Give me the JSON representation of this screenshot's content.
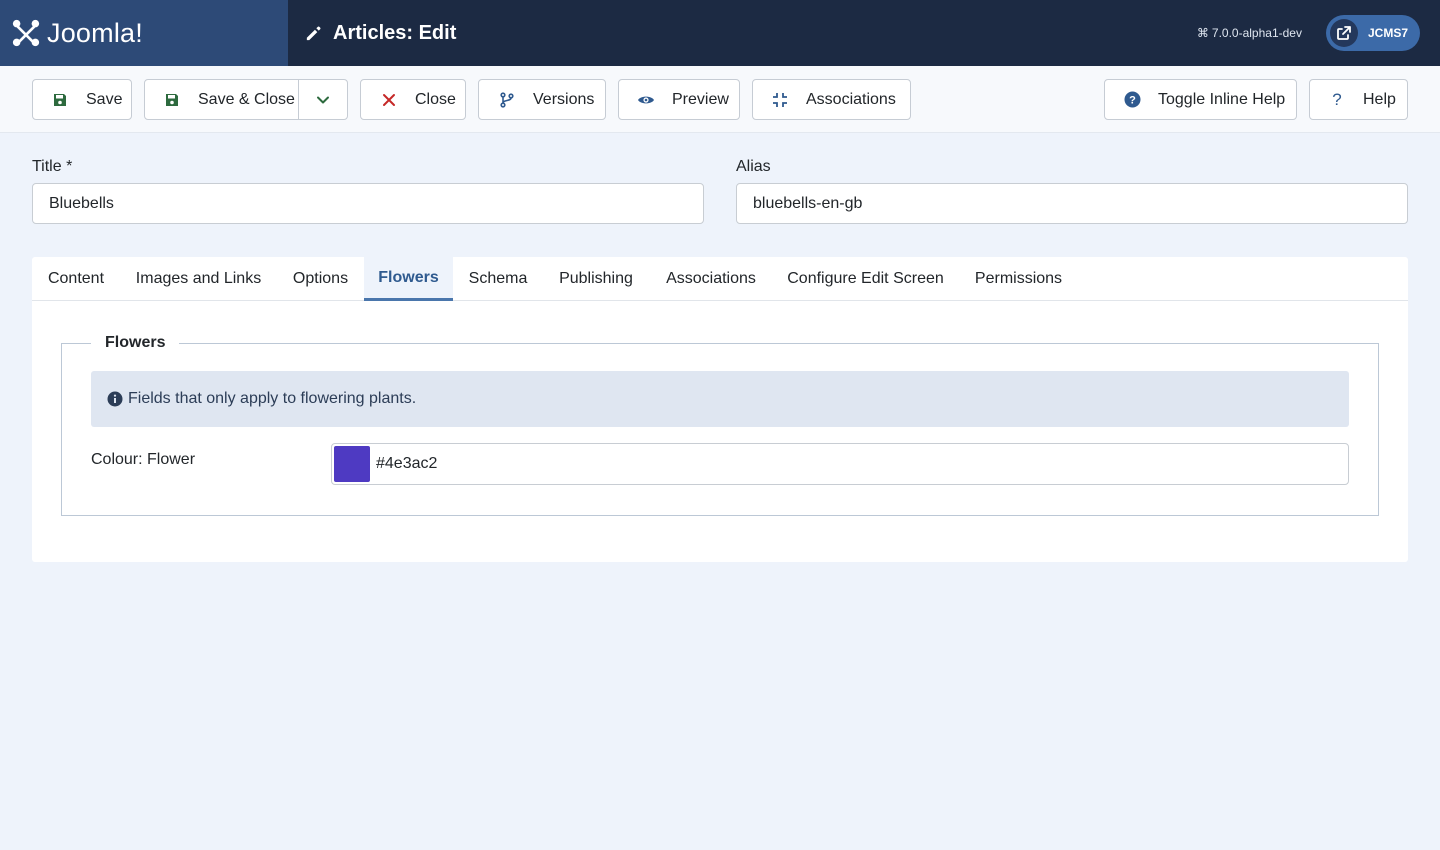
{
  "header": {
    "brand": "Joomla!",
    "page_title": "Articles: Edit",
    "version": "7.0.0-alpha1-dev",
    "user_label": "JCMS7"
  },
  "toolbar": {
    "save": "Save",
    "save_close": "Save & Close",
    "close": "Close",
    "versions": "Versions",
    "preview": "Preview",
    "associations": "Associations",
    "toggle_help": "Toggle Inline Help",
    "help": "Help"
  },
  "form": {
    "title_label": "Title *",
    "title_value": "Bluebells",
    "alias_label": "Alias",
    "alias_value": "bluebells-en-gb"
  },
  "tabs": [
    {
      "label": "Content",
      "active": false
    },
    {
      "label": "Images and Links",
      "active": false
    },
    {
      "label": "Options",
      "active": false
    },
    {
      "label": "Flowers",
      "active": true
    },
    {
      "label": "Schema",
      "active": false
    },
    {
      "label": "Publishing",
      "active": false
    },
    {
      "label": "Associations",
      "active": false
    },
    {
      "label": "Configure Edit Screen",
      "active": false
    },
    {
      "label": "Permissions",
      "active": false
    }
  ],
  "flowers": {
    "legend": "Flowers",
    "info": "Fields that only apply to flowering plants.",
    "colour_label": "Colour: Flower",
    "colour_value": "#4e3ac2"
  },
  "colors": {
    "header_bg": "#1c2a43",
    "logo_bg": "#2d4a77",
    "accent": "#2f5a8f",
    "save_icon": "#2d6a3e",
    "close_icon": "#c52827",
    "swatch": "#4e3ac2"
  }
}
